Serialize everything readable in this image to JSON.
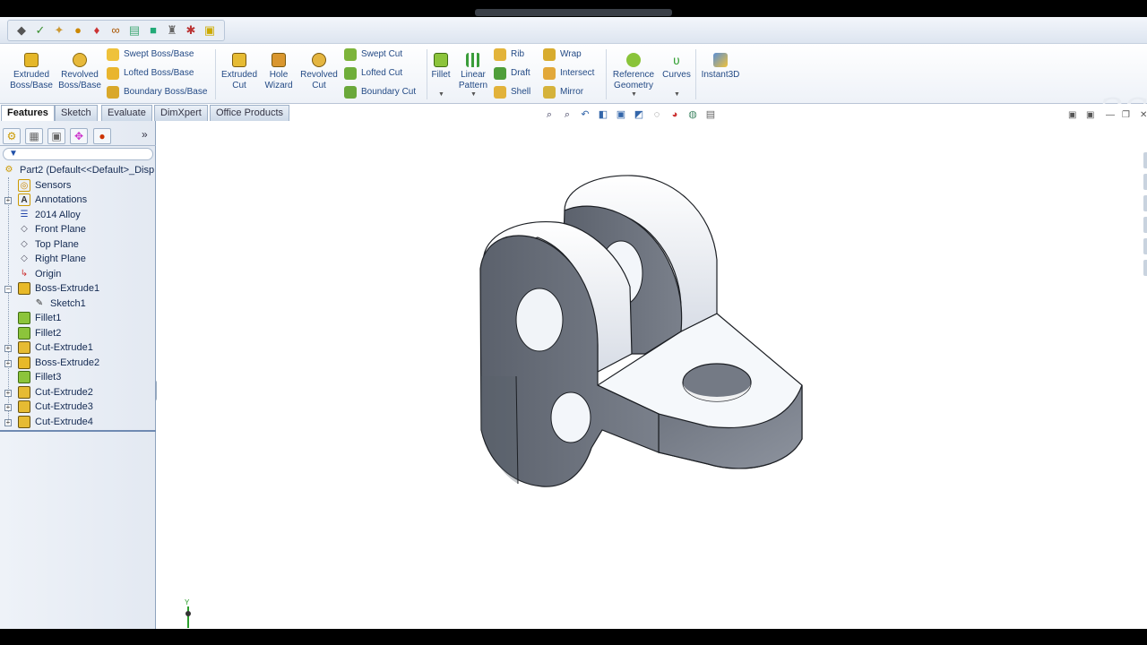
{
  "quick_access": {
    "icons": [
      "cube-icon",
      "rebuild-icon",
      "options-icon",
      "appearance-icon",
      "mate-icon",
      "link-icon",
      "book-icon",
      "color-icon",
      "pin-icon",
      "magnet-icon",
      "warning-icon"
    ]
  },
  "ribbon": {
    "extruded_boss": "Extruded Boss/Base",
    "revolved_boss": "Revolved Boss/Base",
    "swept_boss": "Swept Boss/Base",
    "lofted_boss": "Lofted Boss/Base",
    "boundary_boss": "Boundary Boss/Base",
    "extruded_cut": "Extruded Cut",
    "hole_wizard": "Hole Wizard",
    "revolved_cut": "Revolved Cut",
    "swept_cut": "Swept Cut",
    "lofted_cut": "Lofted Cut",
    "boundary_cut": "Boundary Cut",
    "fillet": "Fillet",
    "linear_pattern": "Linear Pattern",
    "rib": "Rib",
    "draft": "Draft",
    "shell": "Shell",
    "wrap": "Wrap",
    "intersect": "Intersect",
    "mirror": "Mirror",
    "reference_geometry": "Reference Geometry",
    "curves": "Curves",
    "instant3d": "Instant3D"
  },
  "tabs": [
    "Features",
    "Sketch",
    "Evaluate",
    "DimXpert",
    "Office Products"
  ],
  "tree": {
    "root": "Part2  (Default<<Default>_Disp",
    "items": [
      "Sensors",
      "Annotations",
      "2014 Alloy",
      "Front Plane",
      "Top Plane",
      "Right Plane",
      "Origin",
      "Boss-Extrude1",
      "Sketch1",
      "Fillet1",
      "Fillet2",
      "Cut-Extrude1",
      "Boss-Extrude2",
      "Fillet3",
      "Cut-Extrude2",
      "Cut-Extrude3",
      "Cut-Extrude4"
    ]
  },
  "triad_label": "Y",
  "colors": {
    "accent": "#1f4fa8",
    "model_shade": "#6e7480",
    "model_light": "#f2f6fb"
  }
}
